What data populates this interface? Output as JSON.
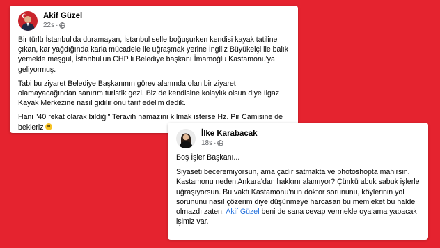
{
  "posts": [
    {
      "author": "Akif Güzel",
      "time": "22s",
      "avatar_icon": "flag-portrait-icon",
      "paragraphs": [
        "Bir türlü İstanbul'da duramayan, İstanbul selle boğuşurken kendisi kayak tatiline çıkan, kar yağdığında karla mücadele ile uğraşmak yerine İngiliz Büyükelçi ile balık yemekle meşgul, İstanbul'un CHP li Belediye başkanı İmamoğlu Kastamonu'ya geliyormuş.",
        "Tabi bu ziyaret Belediye Başkanının görev alanında olan bir ziyaret olamayacağından sanırım turistik gezi. Biz de kendisine kolaylık olsun diye Ilgaz Kayak Merkezine nasıl gidilir onu tarif edelim dedik.",
        "Hani \"40 rekat olarak bildiği\" Teravih namazını kılmak isterse Hz. Pir Camisine de bekleriz"
      ],
      "emoji": "smile-emoji-icon"
    },
    {
      "author": "İlke Karabacak",
      "time": "18s",
      "avatar_icon": "portrait-icon",
      "paragraphs": [
        "Boş İşler Başkanı...",
        "Siyaseti beceremiyorsun, ama çadır satmakta ve photoshopta mahirsin. Kastamonu neden Ankara'dan hakkını alamıyor? Çünkü abuk sabuk işlerle uğraşıyorsun. Bu vakti Kastamonu'nun doktor sorununu, köylerinin yol sorununu nasıl çözerim diye düşünmeye harcasan bu memleket bu halde olmazdı zaten."
      ],
      "mention": "Akif Güzel",
      "after_mention": " beni de sana cevap vermekle oyalama yapacak işimiz var."
    }
  ],
  "colors": {
    "background": "#e5232f",
    "link": "#216fdb",
    "meta": "#65676b"
  }
}
